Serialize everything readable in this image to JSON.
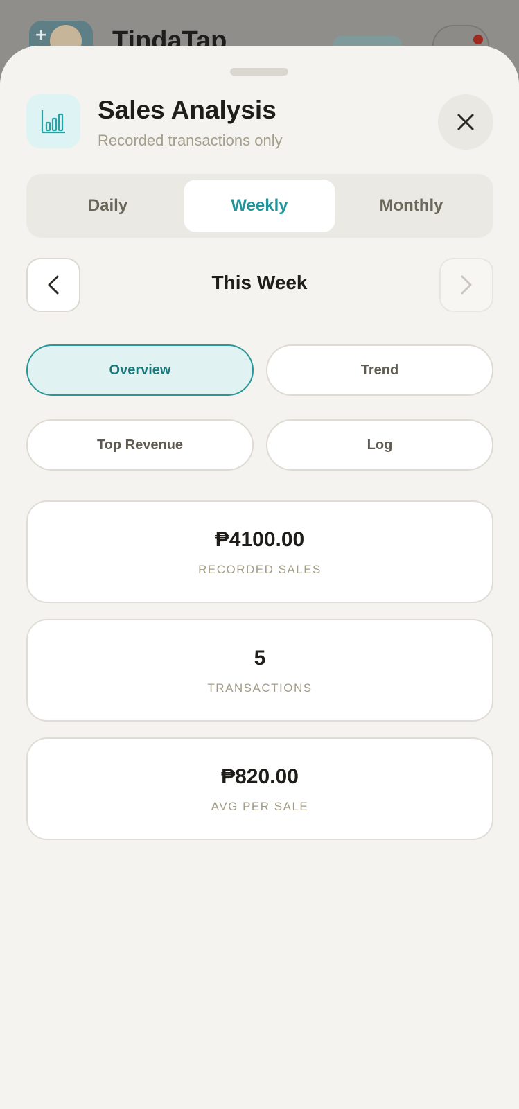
{
  "background_app": {
    "title": "TindaTap"
  },
  "sheet": {
    "title": "Sales Analysis",
    "subtitle": "Recorded transactions only",
    "icon": "bar-chart-icon",
    "close_icon": "close-icon"
  },
  "period_tabs": {
    "items": [
      {
        "label": "Daily",
        "active": false
      },
      {
        "label": "Weekly",
        "active": true
      },
      {
        "label": "Monthly",
        "active": false
      }
    ]
  },
  "period_nav": {
    "label": "This Week",
    "prev_enabled": true,
    "next_enabled": false
  },
  "view_tabs": {
    "items": [
      {
        "label": "Overview",
        "active": true
      },
      {
        "label": "Trend",
        "active": false
      },
      {
        "label": "Top Revenue",
        "active": false
      },
      {
        "label": "Log",
        "active": false
      }
    ]
  },
  "stats": [
    {
      "value": "₱4100.00",
      "label": "RECORDED SALES"
    },
    {
      "value": "5",
      "label": "TRANSACTIONS"
    },
    {
      "value": "₱820.00",
      "label": "AVG PER SALE"
    }
  ],
  "colors": {
    "accent": "#21959a",
    "sheet_bg": "#f4f3ef",
    "muted_text": "#a49e8a"
  }
}
